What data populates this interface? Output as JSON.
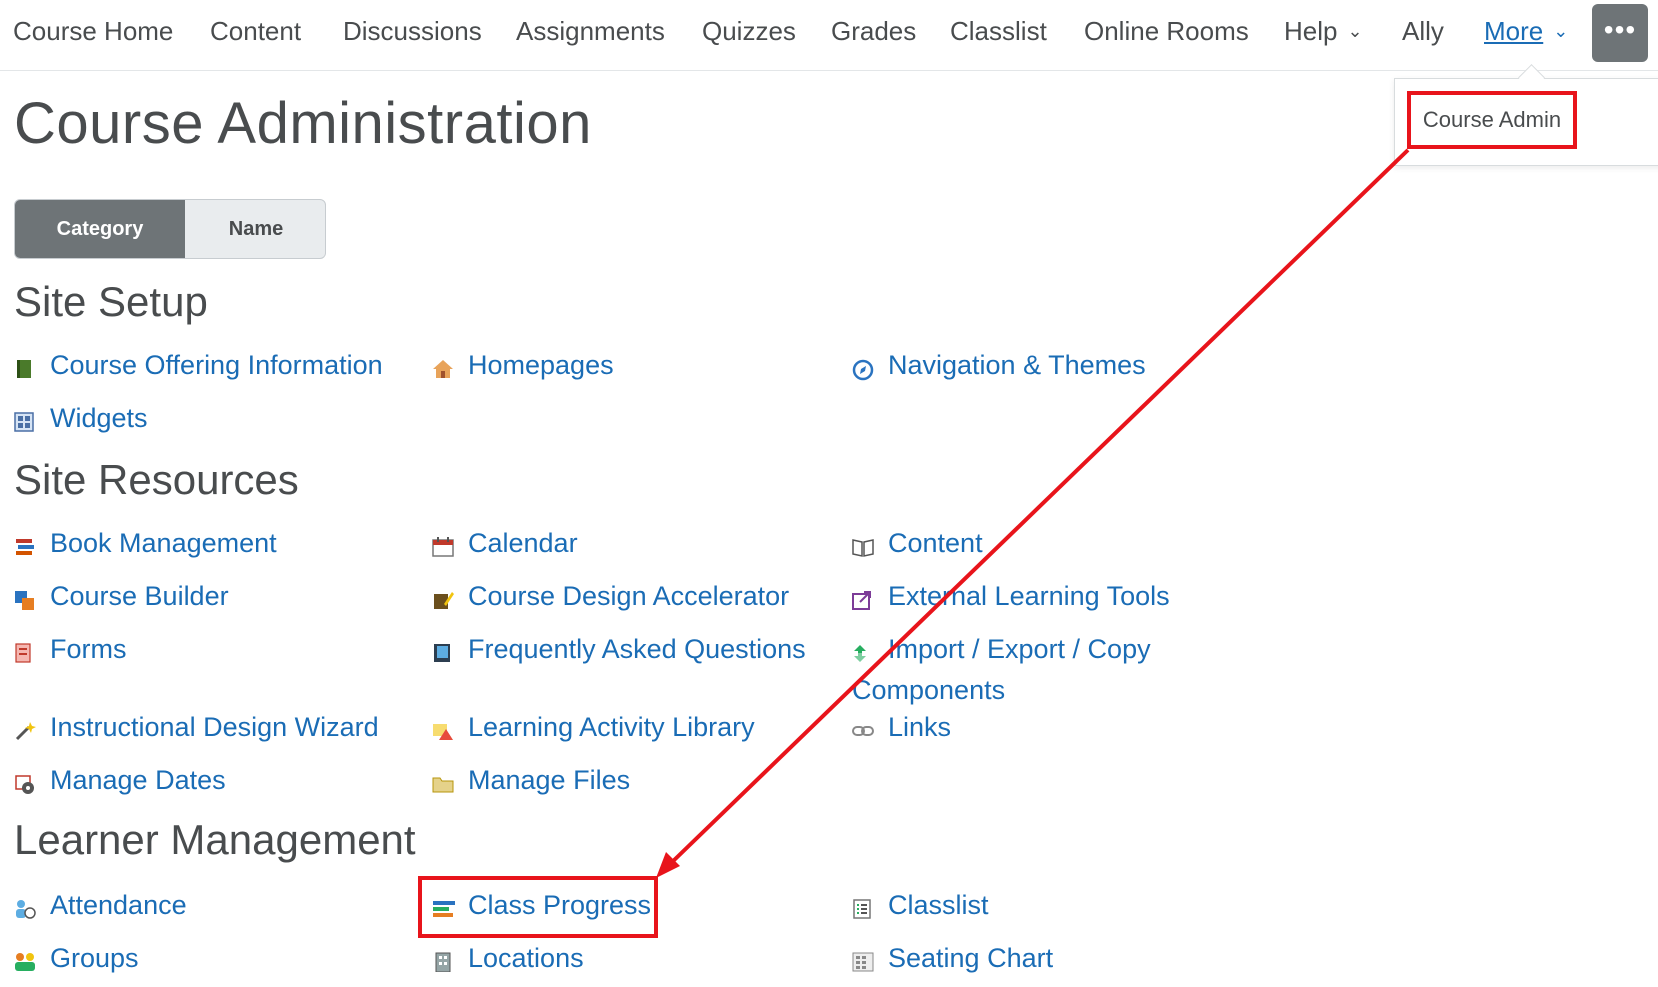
{
  "nav": {
    "items": [
      "Course Home",
      "Content",
      "Discussions",
      "Assignments",
      "Quizzes",
      "Grades",
      "Classlist",
      "Online Rooms",
      "Help",
      "Ally",
      "More"
    ],
    "help_chevron": "chevron-down",
    "more_chevron": "chevron-down",
    "overflow_glyph": "•••"
  },
  "dropdown": {
    "item": "Course Admin"
  },
  "page": {
    "title": "Course Administration"
  },
  "toggle": {
    "category": "Category",
    "name": "Name"
  },
  "sections": [
    {
      "title": "Site Setup",
      "links": [
        {
          "label": "Course Offering Information",
          "icon": "book-green-icon"
        },
        {
          "label": "Homepages",
          "icon": "house-icon"
        },
        {
          "label": "Navigation & Themes",
          "icon": "compass-icon"
        },
        {
          "label": "Widgets",
          "icon": "widget-grid-icon"
        }
      ]
    },
    {
      "title": "Site Resources",
      "links": [
        {
          "label": "Book Management",
          "icon": "books-stack-icon"
        },
        {
          "label": "Calendar",
          "icon": "calendar-icon"
        },
        {
          "label": "Content",
          "icon": "open-book-icon"
        },
        {
          "label": "Course Builder",
          "icon": "blocks-icon"
        },
        {
          "label": "Course Design Accelerator",
          "icon": "pencil-book-icon"
        },
        {
          "label": "External Learning Tools",
          "icon": "external-tool-icon"
        },
        {
          "label": "Forms",
          "icon": "forms-icon"
        },
        {
          "label": "Frequently Asked Questions",
          "icon": "faq-icon"
        },
        {
          "label": "Import / Export / Copy",
          "label2": "Components",
          "icon": "import-export-icon"
        },
        {
          "label": "Instructional Design Wizard",
          "icon": "wand-icon"
        },
        {
          "label": "Learning Activity Library",
          "icon": "activity-library-icon"
        },
        {
          "label": "Links",
          "icon": "chain-link-icon"
        },
        {
          "label": "Manage Dates",
          "icon": "gear-calendar-icon"
        },
        {
          "label": "Manage Files",
          "icon": "folder-icon"
        }
      ]
    },
    {
      "title": "Learner Management",
      "links": [
        {
          "label": "Attendance",
          "icon": "attendance-icon"
        },
        {
          "label": "Class Progress",
          "icon": "progress-bars-icon"
        },
        {
          "label": "Classlist",
          "icon": "list-icon"
        },
        {
          "label": "Groups",
          "icon": "group-icon"
        },
        {
          "label": "Locations",
          "icon": "building-icon"
        },
        {
          "label": "Seating Chart",
          "icon": "seating-grid-icon"
        }
      ]
    }
  ],
  "colors": {
    "link": "#1a6cb5",
    "text": "#494c4e",
    "highlight": "#e8141b",
    "toggle_active": "#6e7477"
  }
}
